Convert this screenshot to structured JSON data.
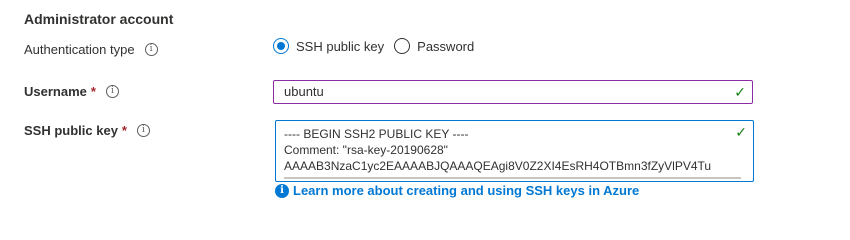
{
  "section": {
    "title": "Administrator account"
  },
  "auth": {
    "label": "Authentication type",
    "info_icon": "info-icon",
    "options": [
      {
        "label": "SSH public key",
        "selected": true
      },
      {
        "label": "Password",
        "selected": false
      }
    ]
  },
  "username": {
    "label": "Username",
    "required_mark": "*",
    "value": "ubuntu",
    "valid_icon": "checkmark-icon"
  },
  "ssh_key": {
    "label": "SSH public key",
    "required_mark": "*",
    "lines": [
      "---- BEGIN SSH2 PUBLIC KEY ----",
      "Comment: \"rsa-key-20190628\"",
      "AAAAB3NzaC1yc2EAAAABJQAAAQEAgi8V0Z2XI4EsRH4OTBmn3fZyVlPV4Tu"
    ],
    "valid_icon": "checkmark-icon"
  },
  "help": {
    "link_text": "Learn more about creating and using SSH keys in Azure",
    "icon": "info-filled-icon"
  },
  "colors": {
    "accent": "#0078d4",
    "valid": "#107c10",
    "required": "#a4262c",
    "focus_border": "#8a2da5"
  }
}
